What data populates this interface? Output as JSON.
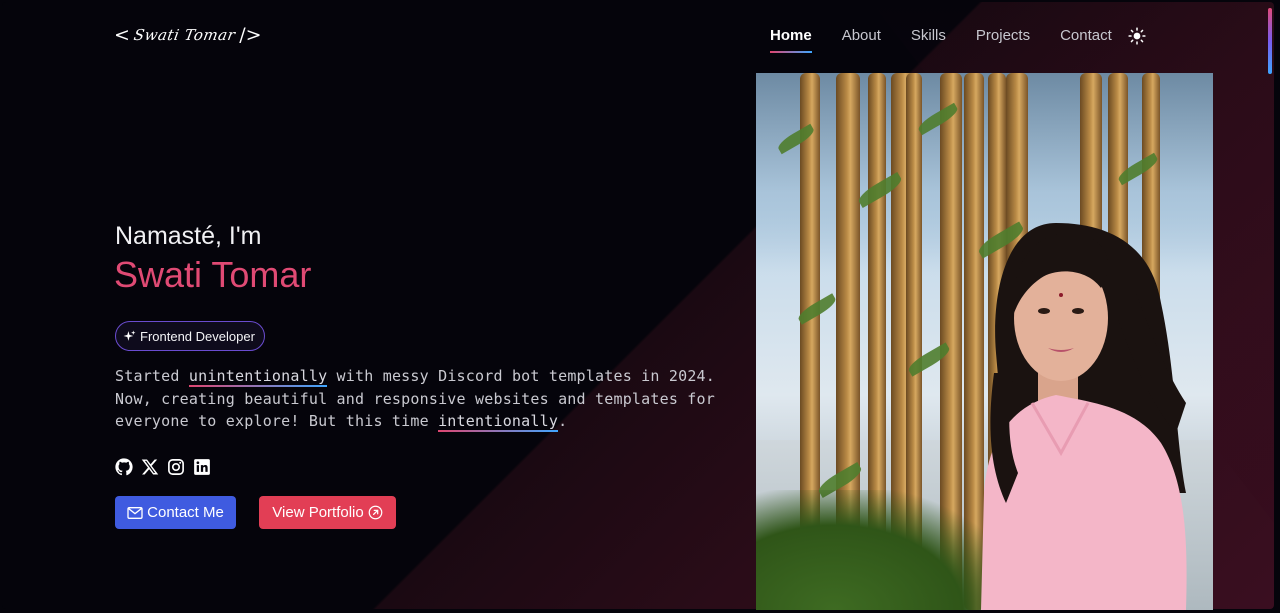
{
  "logo": {
    "open": "<",
    "script": "Swati Tomar",
    "close": "/>"
  },
  "nav": {
    "items": [
      {
        "label": "Home",
        "active": true
      },
      {
        "label": "About",
        "active": false
      },
      {
        "label": "Skills",
        "active": false
      },
      {
        "label": "Projects",
        "active": false
      },
      {
        "label": "Contact",
        "active": false
      }
    ],
    "theme_toggle_icon": "sun-icon"
  },
  "hero": {
    "greeting": "Namasté, I'm",
    "name": "Swati Tomar",
    "badge": {
      "icon": "sparkle-icon",
      "label": "Frontend Developer"
    },
    "description": {
      "part1": "Started ",
      "highlight1": "unintentionally",
      "part2": " with messy Discord bot templates in 2024. Now, creating beautiful and responsive websites and templates for everyone to explore! But this time ",
      "highlight2": "intentionally",
      "part3": "."
    },
    "socials": [
      "github-icon",
      "x-icon",
      "instagram-icon",
      "linkedin-icon"
    ],
    "buttons": {
      "contact": {
        "label": "Contact Me",
        "icon": "envelope-icon"
      },
      "portfolio": {
        "label": "View Portfolio",
        "icon": "arrow-up-right-circle-icon"
      }
    }
  },
  "colors": {
    "background": "#05040b",
    "accent_pink": "#e04a74",
    "contact_button": "#3f5be0",
    "portfolio_button": "#e23e55",
    "badge_border": "#6a4cd0"
  }
}
